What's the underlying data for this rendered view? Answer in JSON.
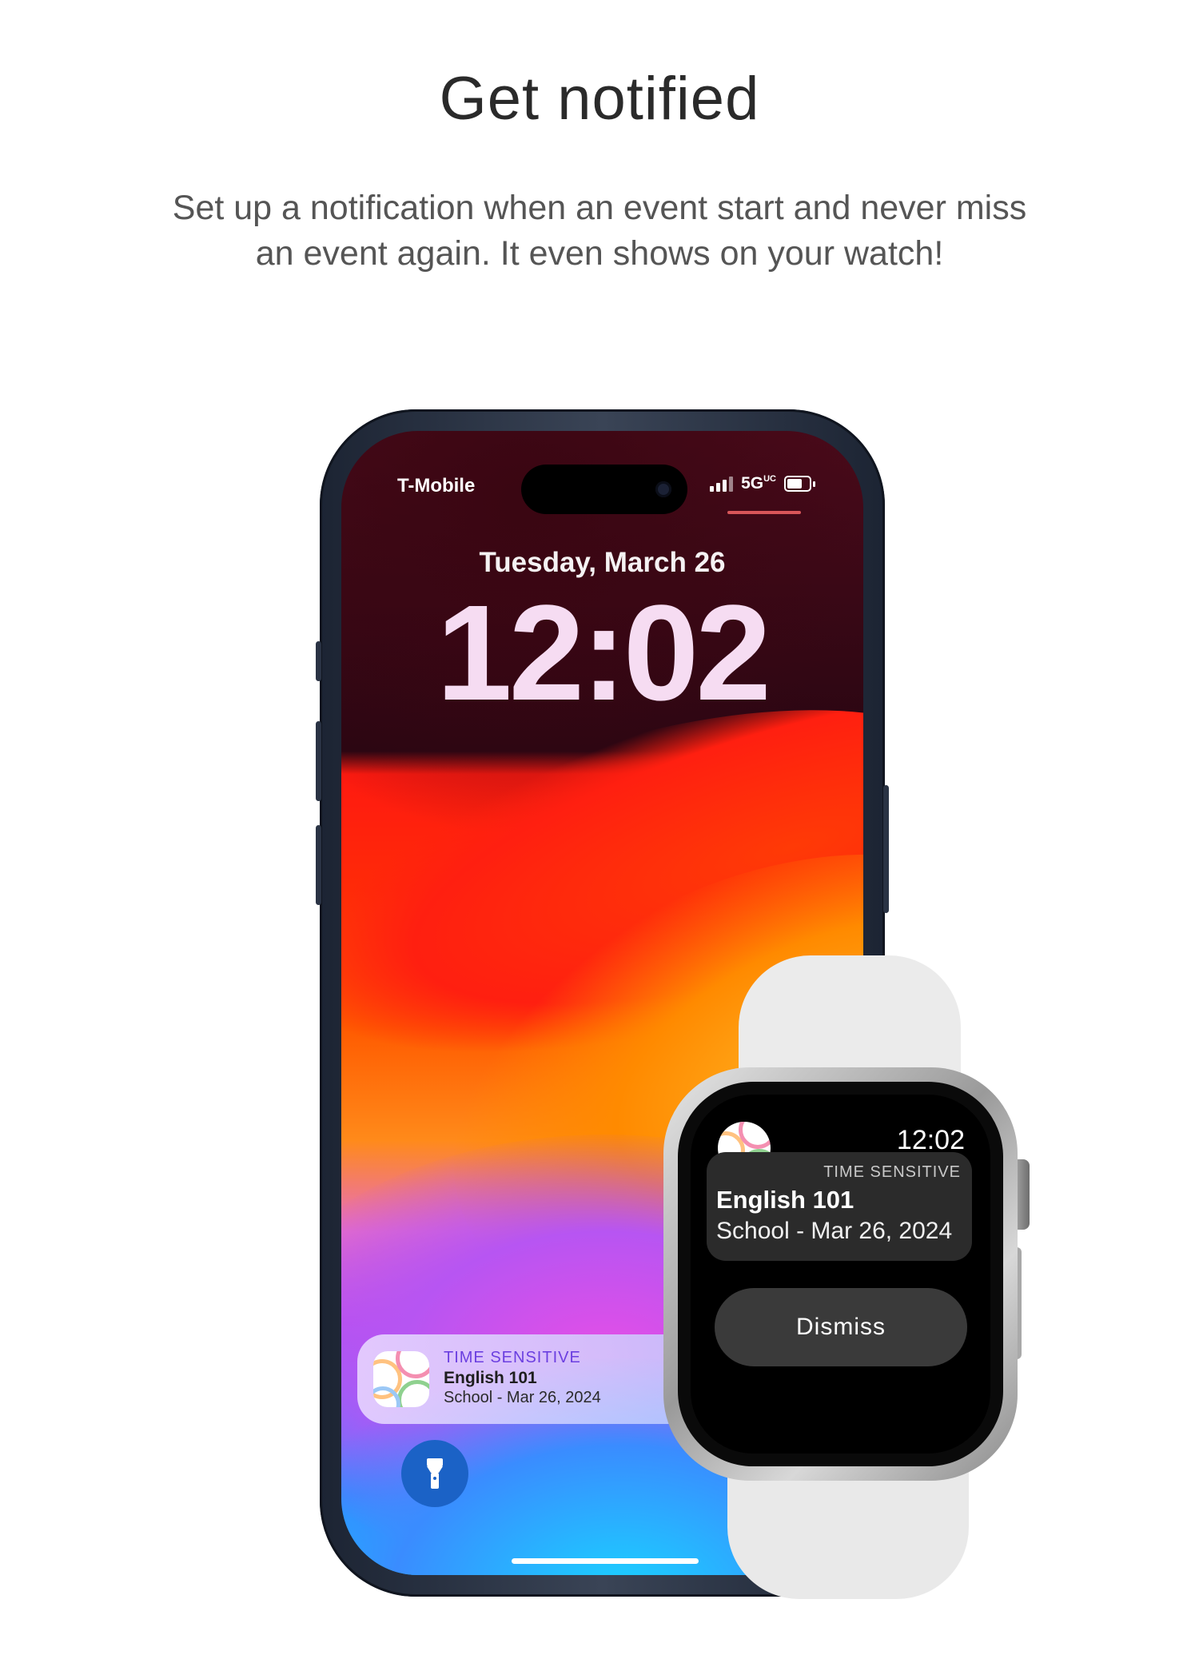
{
  "heading": "Get notified",
  "subtitle_line1": "Set up a notification when an event start and never miss",
  "subtitle_line2": "an event again. It even shows on your watch!",
  "phone": {
    "status": {
      "carrier": "T-Mobile",
      "network": "5G",
      "network_suffix": "UC"
    },
    "lockscreen": {
      "date": "Tuesday, March 26",
      "time": "12:02"
    },
    "notification": {
      "tag": "TIME SENSITIVE",
      "title": "English 101",
      "body": "School - Mar 26, 2024"
    },
    "flashlight_icon": "flashlight-icon"
  },
  "watch": {
    "time": "12:02",
    "notification": {
      "tag": "TIME SENSITIVE",
      "title": "English 101",
      "body": "School - Mar 26, 2024"
    },
    "dismiss_label": "Dismiss"
  },
  "colors": {
    "heading": "#2a2a2a",
    "subtitle": "#555555",
    "time_sensitive_phone": "#6b3fe0",
    "watch_card": "#2b2b2b",
    "watch_button": "#3a3a3a"
  }
}
